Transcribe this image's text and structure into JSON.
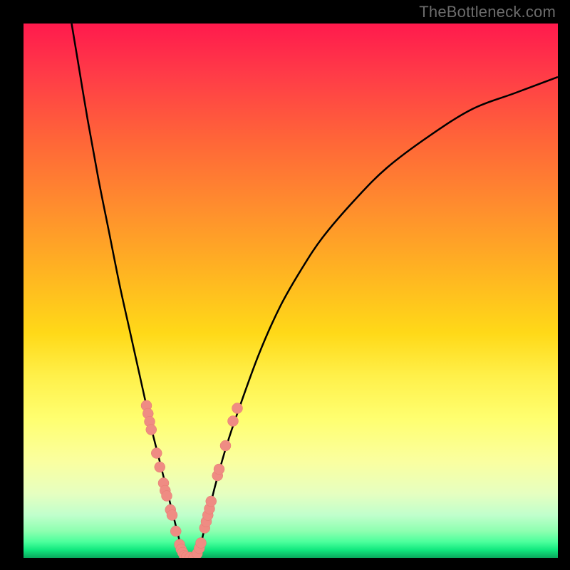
{
  "watermark": "TheBottleneck.com",
  "colors": {
    "frame": "#000000",
    "curve": "#000000",
    "marker_fill": "#ef8c83",
    "marker_stroke": "#e57a71"
  },
  "chart_data": {
    "type": "line",
    "title": "",
    "xlabel": "",
    "ylabel": "",
    "xlim": [
      0,
      100
    ],
    "ylim": [
      0,
      100
    ],
    "grid": false,
    "legend": false,
    "annotations": [],
    "series": [
      {
        "name": "bottleneck-curve-left",
        "x": [
          9,
          10,
          12,
          14,
          16,
          18,
          20,
          22,
          24,
          25,
          26,
          27,
          28,
          28.5,
          29,
          29.5,
          30
        ],
        "y": [
          100,
          94,
          82,
          71,
          61,
          51,
          42,
          33,
          24,
          20,
          16,
          12,
          8,
          6,
          4,
          2,
          0
        ]
      },
      {
        "name": "bottleneck-curve-right",
        "x": [
          32,
          33,
          34,
          35,
          36,
          38,
          40,
          44,
          48,
          52,
          56,
          62,
          68,
          76,
          84,
          92,
          100
        ],
        "y": [
          0,
          2,
          6,
          10,
          14,
          21,
          27,
          38,
          47,
          54,
          60,
          67,
          73,
          79,
          84,
          87,
          90
        ]
      }
    ],
    "markers": [
      {
        "name": "left-cluster",
        "points": [
          {
            "x": 23.0,
            "y": 28.5
          },
          {
            "x": 23.3,
            "y": 27.0
          },
          {
            "x": 23.6,
            "y": 25.5
          },
          {
            "x": 23.9,
            "y": 24.0
          },
          {
            "x": 24.9,
            "y": 19.6
          },
          {
            "x": 25.5,
            "y": 17.0
          },
          {
            "x": 26.2,
            "y": 14.0
          },
          {
            "x": 26.5,
            "y": 12.6
          },
          {
            "x": 26.8,
            "y": 11.6
          },
          {
            "x": 27.5,
            "y": 9.0
          },
          {
            "x": 27.8,
            "y": 8.0
          },
          {
            "x": 28.5,
            "y": 5.0
          },
          {
            "x": 29.2,
            "y": 2.5
          },
          {
            "x": 29.5,
            "y": 1.6
          },
          {
            "x": 29.8,
            "y": 1.0
          },
          {
            "x": 30.1,
            "y": 0.4
          }
        ]
      },
      {
        "name": "valley-floor",
        "points": [
          {
            "x": 30.5,
            "y": 0.2
          },
          {
            "x": 31.2,
            "y": 0.1
          },
          {
            "x": 31.9,
            "y": 0.15
          }
        ]
      },
      {
        "name": "right-cluster",
        "points": [
          {
            "x": 32.5,
            "y": 0.8
          },
          {
            "x": 32.9,
            "y": 1.8
          },
          {
            "x": 33.2,
            "y": 2.8
          },
          {
            "x": 33.9,
            "y": 5.6
          },
          {
            "x": 34.2,
            "y": 6.8
          },
          {
            "x": 34.5,
            "y": 8.0
          },
          {
            "x": 34.8,
            "y": 9.2
          },
          {
            "x": 35.1,
            "y": 10.6
          },
          {
            "x": 36.3,
            "y": 15.4
          },
          {
            "x": 36.6,
            "y": 16.6
          },
          {
            "x": 37.8,
            "y": 21.0
          },
          {
            "x": 39.2,
            "y": 25.6
          },
          {
            "x": 40.0,
            "y": 28.0
          }
        ]
      }
    ]
  }
}
